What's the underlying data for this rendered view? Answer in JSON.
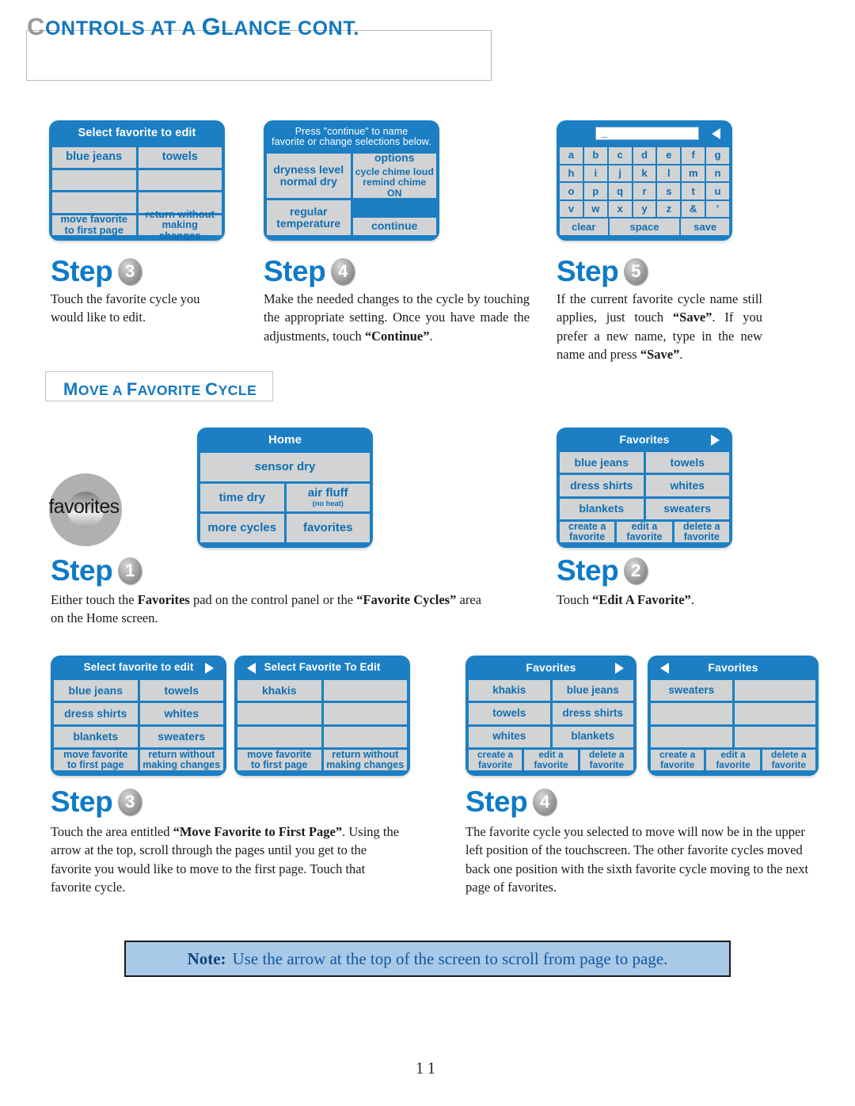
{
  "page": {
    "title_drop_cap": "C",
    "title_rest": "ONTROLS AT A ",
    "title_cap2": "G",
    "title_tail": "LANCE CONT.",
    "title_full": "Controls at a Glance cont.",
    "page_number": "11"
  },
  "section": {
    "move_favorite_heading_cap1": "M",
    "move_favorite_heading_p1": "OVE A ",
    "move_favorite_heading_cap2": "F",
    "move_favorite_heading_p2": "AVORITE ",
    "move_favorite_heading_cap3": "C",
    "move_favorite_heading_p3": "YCLE",
    "move_favorite_heading_full": "Move a Favorite Cycle"
  },
  "screens": {
    "select_favorite_edit_top": {
      "header": "Select favorite to edit",
      "arrow": "none",
      "rows": [
        [
          "blue jeans",
          "towels"
        ],
        [
          "",
          ""
        ],
        [
          "",
          ""
        ],
        [
          "move favorite\nto first page",
          "return without\nmaking changes"
        ]
      ]
    },
    "edit_cycle_settings": {
      "header_line1": "Press \"continue\" to name",
      "header_line2": "favorite or change selections below.",
      "dryness_title": "dryness level",
      "dryness_value": "normal dry",
      "options_title": "options",
      "options_line1": "cycle chime loud",
      "options_line2": "remind chime ON",
      "temp_title": "regular",
      "temp_value": "temperature",
      "continue_label": "continue"
    },
    "keyboard": {
      "input_value": "_",
      "arrow": "left",
      "rows": [
        [
          "a",
          "b",
          "c",
          "d",
          "e",
          "f",
          "g"
        ],
        [
          "h",
          "i",
          "j",
          "k",
          "l",
          "m",
          "n"
        ],
        [
          "o",
          "p",
          "q",
          "r",
          "s",
          "t",
          "u"
        ],
        [
          "v",
          "w",
          "x",
          "y",
          "z",
          "&",
          "'"
        ]
      ],
      "clear_label": "clear",
      "space_label": "space",
      "save_label": "save"
    },
    "home": {
      "header": "Home",
      "sensor_dry": "sensor dry",
      "time_dry": "time dry",
      "air_fluff": "air fluff",
      "air_fluff_sub": "(no heat)",
      "more_cycles": "more cycles",
      "favorites": "favorites"
    },
    "favorites_main": {
      "header": "Favorites",
      "arrow": "right",
      "rows": [
        [
          "blue jeans",
          "towels"
        ],
        [
          "dress shirts",
          "whites"
        ],
        [
          "blankets",
          "sweaters"
        ]
      ],
      "actions": [
        "create a\nfavorite",
        "edit a\nfavorite",
        "delete a\nfavorite"
      ]
    },
    "select_favorite_edit_p1": {
      "header": "Select favorite to edit",
      "arrow": "right",
      "rows": [
        [
          "blue jeans",
          "towels"
        ],
        [
          "dress shirts",
          "whites"
        ],
        [
          "blankets",
          "sweaters"
        ]
      ],
      "actions": [
        "move favorite\nto first page",
        "return without\nmaking changes"
      ]
    },
    "select_favorite_edit_p2": {
      "header": "Select Favorite To Edit",
      "arrow": "left",
      "rows": [
        [
          "khakis",
          ""
        ],
        [
          "",
          ""
        ],
        [
          "",
          ""
        ]
      ],
      "actions": [
        "move favorite\nto first page",
        "return without\nmaking changes"
      ]
    },
    "favorites_after_p1": {
      "header": "Favorites",
      "arrow": "right",
      "rows": [
        [
          "khakis",
          "blue jeans"
        ],
        [
          "towels",
          "dress shirts"
        ],
        [
          "whites",
          "blankets"
        ]
      ],
      "actions": [
        "create a\nfavorite",
        "edit a\nfavorite",
        "delete a\nfavorite"
      ]
    },
    "favorites_after_p2": {
      "header": "Favorites",
      "arrow": "left",
      "rows": [
        [
          "sweaters",
          ""
        ],
        [
          "",
          ""
        ],
        [
          "",
          ""
        ]
      ],
      "actions": [
        "create a\nfavorite",
        "edit a\nfavorite",
        "delete a\nfavorite"
      ]
    }
  },
  "steps": {
    "word": "Step",
    "edit_step3": {
      "number": "3",
      "text": "Touch the favorite cycle you would like to edit."
    },
    "edit_step4": {
      "number": "4",
      "text_pre": "Make the needed changes to the cycle by touching the appropriate setting.  Once you have made the adjustments,  touch ",
      "text_bold": "“Continue”",
      "text_post": "."
    },
    "edit_step5": {
      "number": "5",
      "text_pre": "If the current favorite cycle name still applies, just touch ",
      "text_bold1": "“Save”",
      "text_mid": ".  If you prefer a new name, type in the new name and press ",
      "text_bold2": "“Save”",
      "text_post": "."
    },
    "move_step1": {
      "number": "1",
      "text_pre": "Either touch the ",
      "text_bold1": "Favorites",
      "text_mid": " pad on the control panel or the ",
      "text_bold2": "“Favorite Cycles”",
      "text_post": " area on the Home screen."
    },
    "move_step2": {
      "number": "2",
      "text_pre": "Touch ",
      "text_bold": "“Edit A Favorite”",
      "text_post": "."
    },
    "move_step3": {
      "number": "3",
      "text_pre": "Touch the area entitled ",
      "text_bold": "“Move Favorite to First Page”",
      "text_post": ". Using the arrow at the top, scroll through the pages until you get to the favorite you would like to move to the first page. Touch that favorite cycle."
    },
    "move_step4": {
      "number": "4",
      "text": "The favorite cycle you selected to move will now be in the upper left position of the touchscreen. The other favorite cycles moved back one position with the sixth favorite cycle moving to the next page of favorites."
    }
  },
  "note": {
    "label": "Note:",
    "text": "Use the arrow at the top of the screen to scroll from page to page."
  },
  "colors": {
    "screen_blue": "#1C7FC4",
    "cell_gray": "#d2d3d4",
    "cell_text_blue": "#0F6FB4",
    "heading_blue": "#1478BE",
    "note_bg": "#a9c9e8"
  }
}
